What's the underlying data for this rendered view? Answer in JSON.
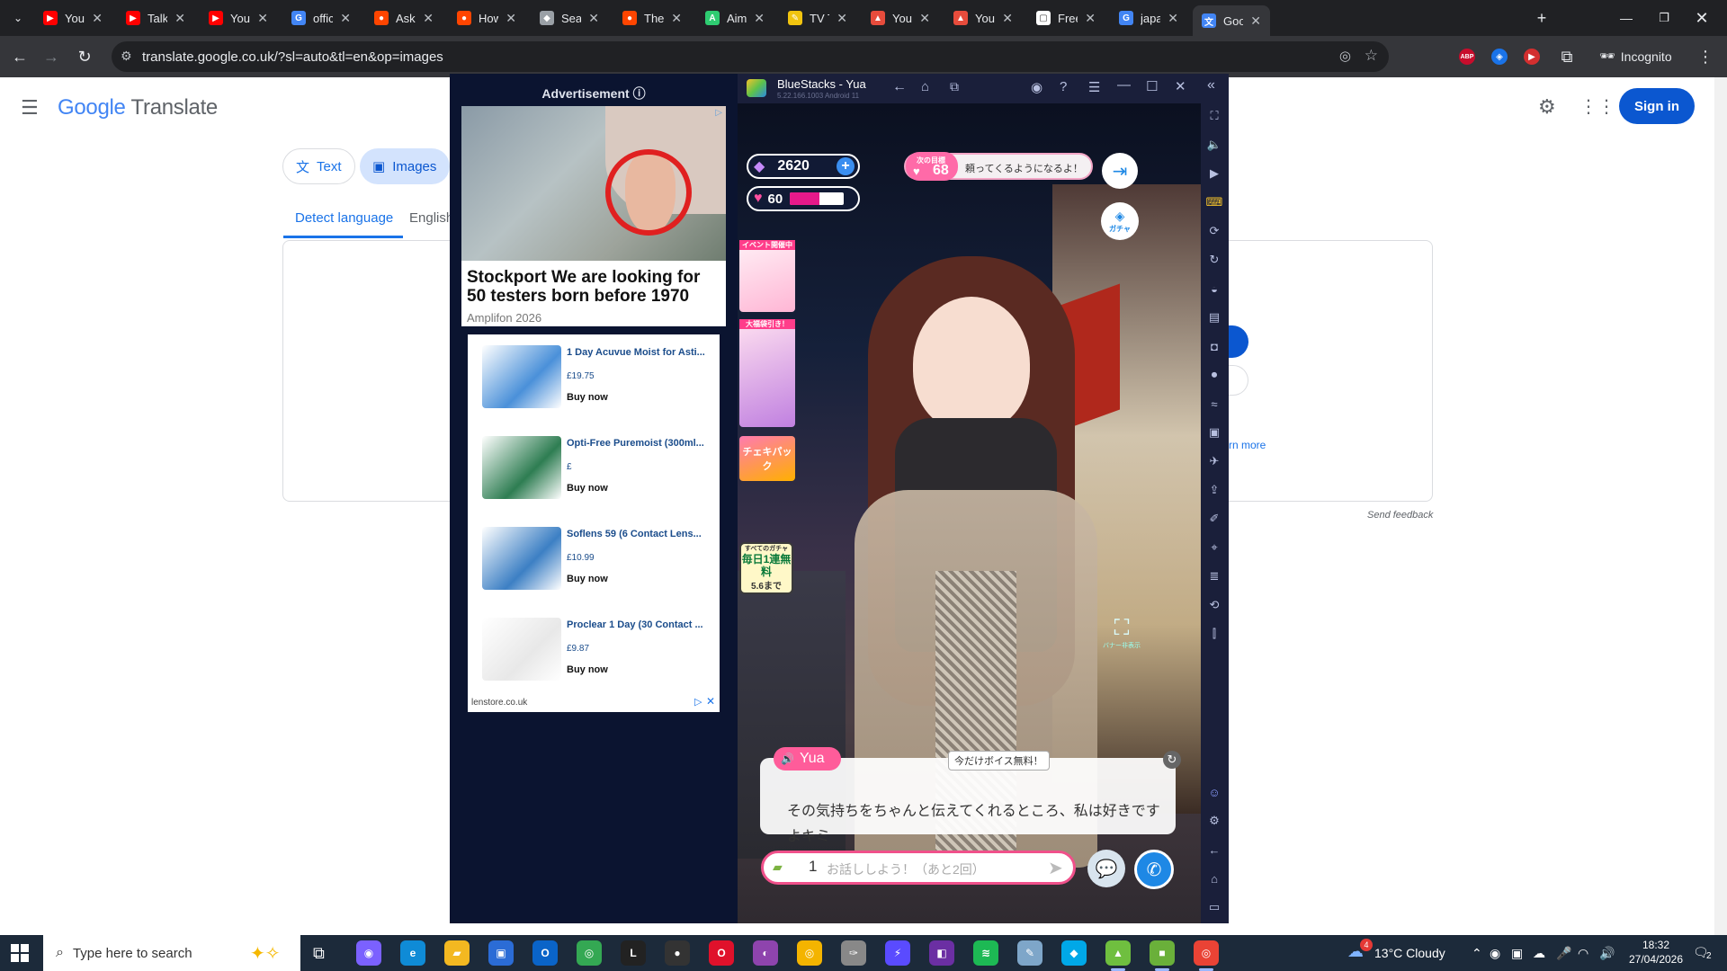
{
  "browser": {
    "tabs": [
      {
        "title": "YouTub",
        "icon": "youtube-icon",
        "color": "#ff0000",
        "glyph": "▶"
      },
      {
        "title": "Talking",
        "icon": "youtube-icon",
        "color": "#ff0000",
        "glyph": "▶"
      },
      {
        "title": "YouTub",
        "icon": "youtube-icon",
        "color": "#ff0000",
        "glyph": "▶"
      },
      {
        "title": "official",
        "icon": "google-docs-icon",
        "color": "#4285f4",
        "glyph": "G"
      },
      {
        "title": "AskMe",
        "icon": "reddit-icon",
        "color": "#ff4500",
        "glyph": "●"
      },
      {
        "title": "How d",
        "icon": "reddit-icon",
        "color": "#ff4500",
        "glyph": "●"
      },
      {
        "title": "Search",
        "icon": "document-icon",
        "color": "#9aa0a6",
        "glyph": "◆"
      },
      {
        "title": "The Le",
        "icon": "reddit-icon",
        "color": "#ff4500",
        "glyph": "●"
      },
      {
        "title": "Aimy A",
        "icon": "aimy-icon",
        "color": "#2ecc71",
        "glyph": "A"
      },
      {
        "title": "TV Trop",
        "icon": "tvtropes-icon",
        "color": "#f1c40f",
        "glyph": "✎"
      },
      {
        "title": "Youko",
        "icon": "site-icon",
        "color": "#e74c3c",
        "glyph": "▲"
      },
      {
        "title": "You're",
        "icon": "site-icon",
        "color": "#e74c3c",
        "glyph": "▲"
      },
      {
        "title": "Freeim",
        "icon": "freeimages-icon",
        "color": "#ffffff",
        "glyph": "▢"
      },
      {
        "title": "japane",
        "icon": "google-icon",
        "color": "#4285f4",
        "glyph": "G"
      },
      {
        "title": "Google",
        "icon": "google-translate-icon",
        "color": "#4285f4",
        "glyph": "文"
      }
    ],
    "url": "translate.google.co.uk/?sl=auto&tl=en&op=images",
    "incognito_label": "Incognito",
    "extensions": [
      {
        "name": "adblock-plus-icon",
        "label": "ABP",
        "color": "#c70d2c"
      },
      {
        "name": "shield-extension-icon",
        "label": "◈",
        "color": "#1a73e8"
      },
      {
        "name": "video-extension-icon",
        "label": "▶",
        "color": "#d32f2f"
      }
    ]
  },
  "translate": {
    "logo_google": "Google",
    "logo_translate": "Translate",
    "mode_tabs": [
      "Text",
      "Images"
    ],
    "lang_tabs": [
      "Detect language",
      "English"
    ],
    "learn_more": "rn more",
    "send_feedback": "Send feedback",
    "sign_in": "Sign in"
  },
  "ad": {
    "header": "Advertisement ⓘ",
    "headline": "Stockport We are looking for 50 testers born before 1970",
    "sponsor": "Amplifon 2026",
    "products": [
      {
        "name": "1 Day Acuvue Moist for Asti...",
        "price": "£19.75",
        "cta": "Buy now",
        "color": "#4a90d9"
      },
      {
        "name": "Opti-Free Puremoist (300ml...",
        "price": "£",
        "cta": "Buy now",
        "color": "#2e7d52"
      },
      {
        "name": "Soflens 59 (6 Contact Lens...",
        "price": "£10.99",
        "cta": "Buy now",
        "color": "#3c7fc4"
      },
      {
        "name": "Proclear 1 Day (30 Contact ...",
        "price": "£9.87",
        "cta": "Buy now",
        "color": "#e8e8e8"
      }
    ],
    "footer_domain": "lenstore.co.uk"
  },
  "bluestacks": {
    "title": "BlueStacks - Yua",
    "version": "5.22.166.1003  Android 11",
    "gems": "2620",
    "hearts": "60",
    "heart_progress": 0.55,
    "goal_label": "次の目標",
    "goal_value": "68",
    "goal_text": "頼ってくるようになるよ！",
    "gacha_label": "ガチャ",
    "event_labels": [
      "イベント開催中",
      "大福袋引き！",
      "チェキパック",
      "すべてのガチャ",
      "毎日1連無料",
      "5.6まで"
    ],
    "banner_hide": "バナー非表示",
    "speaker": "Yua",
    "voice_free": "今だけボイス無料！",
    "dialog": "その気持ちをちゃんと伝えてくれるところ、私は好きですよキミ",
    "ticket_count": "1",
    "input_placeholder": "お話ししよう！（あと2回）"
  },
  "taskbar": {
    "search_placeholder": "Type here to search",
    "weather": "13°C  Cloudy",
    "weather_badge": "4",
    "time": "18:32",
    "date": "27/04/2026",
    "notifications": "2",
    "apps": [
      {
        "name": "copilot-app-icon",
        "color": "#7b61ff",
        "glyph": "◉"
      },
      {
        "name": "edge-app-icon",
        "color": "#0f8bd6",
        "glyph": "e"
      },
      {
        "name": "file-explorer-app-icon",
        "color": "#f3b821",
        "glyph": "▰"
      },
      {
        "name": "store-app-icon",
        "color": "#2b6cd6",
        "glyph": "▣"
      },
      {
        "name": "outlook-app-icon",
        "color": "#0a64c8",
        "glyph": "O"
      },
      {
        "name": "chrome-app-icon",
        "color": "#34a853",
        "glyph": "◎"
      },
      {
        "name": "live-app-icon",
        "color": "#222222",
        "glyph": "L"
      },
      {
        "name": "obs-app-icon",
        "color": "#333333",
        "glyph": "●"
      },
      {
        "name": "opera-app-icon",
        "color": "#e0112b",
        "glyph": "O"
      },
      {
        "name": "media-app-icon",
        "color": "#8e44ad",
        "glyph": "◐"
      },
      {
        "name": "chrome-canary-app-icon",
        "color": "#f4b400",
        "glyph": "◎"
      },
      {
        "name": "feather-app-icon",
        "color": "#888888",
        "glyph": "✑"
      },
      {
        "name": "messenger-app-icon",
        "color": "#5a4bff",
        "glyph": "⚡"
      },
      {
        "name": "dark-app-icon",
        "color": "#6b2fa3",
        "glyph": "◧"
      },
      {
        "name": "spotify-app-icon",
        "color": "#1db954",
        "glyph": "≋"
      },
      {
        "name": "notes-app-icon",
        "color": "#7ea6c9",
        "glyph": "✎"
      },
      {
        "name": "sky-app-icon",
        "color": "#00a8e8",
        "glyph": "◆"
      },
      {
        "name": "bluestacks-app-icon",
        "color": "#6fbf3f",
        "glyph": "▲"
      },
      {
        "name": "green-app-icon",
        "color": "#6ab03a",
        "glyph": "■"
      },
      {
        "name": "chrome-active-app-icon",
        "color": "#ea4335",
        "glyph": "◎"
      }
    ]
  }
}
